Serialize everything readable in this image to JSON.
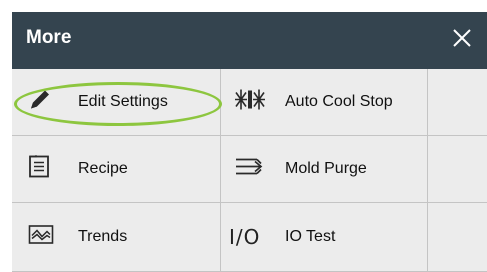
{
  "header": {
    "title": "More",
    "close_icon": "close-icon"
  },
  "menu": [
    {
      "label": "Edit Settings",
      "icon": "pencil-icon"
    },
    {
      "label": "Auto Cool Stop",
      "icon": "snowflake-stop-icon"
    },
    {
      "label": "Recipe",
      "icon": "document-icon"
    },
    {
      "label": "Mold Purge",
      "icon": "purge-arrow-icon"
    },
    {
      "label": "Trends",
      "icon": "trend-chart-icon"
    },
    {
      "label": "IO Test",
      "icon": "io-icon",
      "glyph": "I/O"
    }
  ],
  "colors": {
    "header_bg": "#34444f",
    "panel_bg": "#ececec",
    "highlight": "#8dc63f"
  }
}
